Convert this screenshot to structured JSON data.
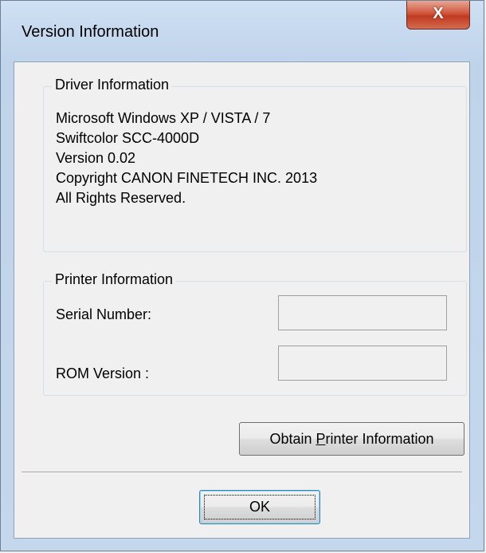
{
  "window": {
    "title": "Version Information",
    "close_symbol": "X"
  },
  "driver_group": {
    "legend": "Driver Information",
    "lines": [
      "Microsoft Windows XP / VISTA / 7",
      "Swiftcolor SCC-4000D",
      "Version 0.02",
      "Copyright CANON FINETECH INC. 2013",
      "All Rights Reserved."
    ]
  },
  "printer_group": {
    "legend": "Printer Information",
    "serial_label": "Serial Number:",
    "serial_value": "",
    "rom_label": "ROM Version :",
    "rom_value": ""
  },
  "buttons": {
    "obtain_prefix": "Obtain ",
    "obtain_accel": "P",
    "obtain_suffix": "rinter Information",
    "ok": "OK"
  }
}
